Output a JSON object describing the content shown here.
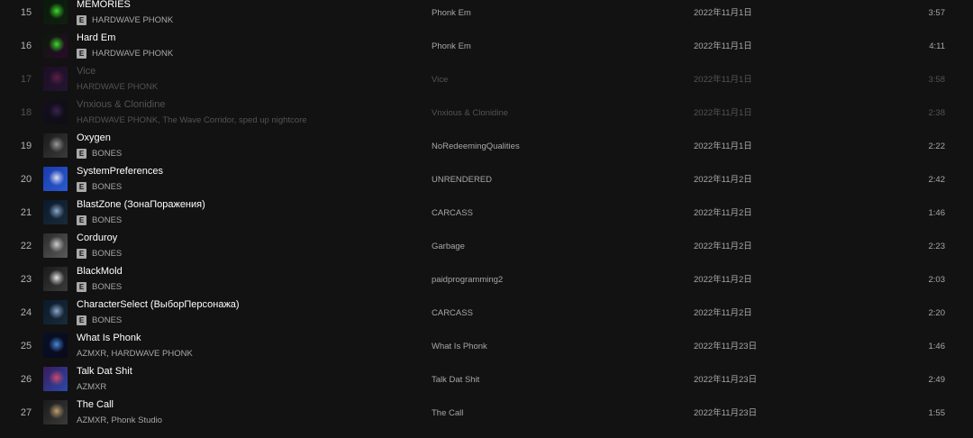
{
  "tracks": [
    {
      "index": "15",
      "title": "MEMORIES",
      "explicit": true,
      "artist": "HARDWAVE PHONK",
      "album": "Phonk Em",
      "date_added": "2022年11月1日",
      "duration": "3:57",
      "unavailable": false,
      "cover_colors": [
        "#0a1a0a",
        "#3ddc2a",
        "#102010"
      ]
    },
    {
      "index": "16",
      "title": "Hard Em",
      "explicit": true,
      "artist": "HARDWAVE PHONK",
      "album": "Phonk Em",
      "date_added": "2022年11月1日",
      "duration": "4:11",
      "unavailable": false,
      "cover_colors": [
        "#0a1a0a",
        "#3ddc2a",
        "#2a0a2a"
      ]
    },
    {
      "index": "17",
      "title": "Vice",
      "explicit": false,
      "artist": "HARDWAVE PHONK",
      "album": "Vice",
      "date_added": "2022年11月1日",
      "duration": "3:58",
      "unavailable": true,
      "cover_colors": [
        "#2a0a3a",
        "#c0308a",
        "#3a1a5a"
      ]
    },
    {
      "index": "18",
      "title": "Vnxious & Clonidine",
      "explicit": false,
      "artist": "HARDWAVE PHONK, The Wave Corridor, sped up nightcore",
      "album": "Vnxious & Clonidine",
      "date_added": "2022年11月1日",
      "duration": "2:38",
      "unavailable": true,
      "cover_colors": [
        "#1a0a2a",
        "#6a3a9a",
        "#0a0a1a"
      ]
    },
    {
      "index": "19",
      "title": "Oxygen",
      "explicit": true,
      "artist": "BONES",
      "album": "NoRedeemingQualities",
      "date_added": "2022年11月1日",
      "duration": "2:22",
      "unavailable": false,
      "cover_colors": [
        "#1a1a1a",
        "#9a9a9a",
        "#3a3a3a"
      ]
    },
    {
      "index": "20",
      "title": "SystemPreferences",
      "explicit": true,
      "artist": "BONES",
      "album": "UNRENDERED",
      "date_added": "2022年11月2日",
      "duration": "2:42",
      "unavailable": false,
      "cover_colors": [
        "#1a3aaa",
        "#e0e0f0",
        "#2a5ad0"
      ]
    },
    {
      "index": "21",
      "title": "BlastZone (ЗонаПоражения)",
      "explicit": true,
      "artist": "BONES",
      "album": "CARCASS",
      "date_added": "2022年11月2日",
      "duration": "1:46",
      "unavailable": false,
      "cover_colors": [
        "#0a1a2a",
        "#8aaacc",
        "#1a2a3a"
      ]
    },
    {
      "index": "22",
      "title": "Corduroy",
      "explicit": true,
      "artist": "BONES",
      "album": "Garbage",
      "date_added": "2022年11月2日",
      "duration": "2:23",
      "unavailable": false,
      "cover_colors": [
        "#2a2a2a",
        "#cfcfcf",
        "#5a5a5a"
      ]
    },
    {
      "index": "23",
      "title": "BlackMold",
      "explicit": true,
      "artist": "BONES",
      "album": "paidprogramming2",
      "date_added": "2022年11月2日",
      "duration": "2:03",
      "unavailable": false,
      "cover_colors": [
        "#1a1a1a",
        "#e8e8e8",
        "#3a3a3a"
      ]
    },
    {
      "index": "24",
      "title": "CharacterSelect (ВыборПерсонажа)",
      "explicit": true,
      "artist": "BONES",
      "album": "CARCASS",
      "date_added": "2022年11月2日",
      "duration": "2:20",
      "unavailable": false,
      "cover_colors": [
        "#0a1a2a",
        "#8aaacc",
        "#1a2a3a"
      ]
    },
    {
      "index": "25",
      "title": "What Is Phonk",
      "explicit": false,
      "artist": "AZMXR, HARDWAVE PHONK",
      "album": "What Is Phonk",
      "date_added": "2022年11月23日",
      "duration": "1:46",
      "unavailable": false,
      "cover_colors": [
        "#05102a",
        "#4a8adf",
        "#0a0a1a"
      ]
    },
    {
      "index": "26",
      "title": "Talk Dat Shit",
      "explicit": false,
      "artist": "AZMXR",
      "album": "Talk Dat Shit",
      "date_added": "2022年11月23日",
      "duration": "2:49",
      "unavailable": false,
      "cover_colors": [
        "#3a1a5a",
        "#d04a6a",
        "#2a4aaa"
      ]
    },
    {
      "index": "27",
      "title": "The Call",
      "explicit": false,
      "artist": "AZMXR, Phonk Studio",
      "album": "The Call",
      "date_added": "2022年11月23日",
      "duration": "1:55",
      "unavailable": false,
      "cover_colors": [
        "#1a1a1a",
        "#c0a070",
        "#3a3a3a"
      ]
    }
  ],
  "explicit_badge": "E"
}
